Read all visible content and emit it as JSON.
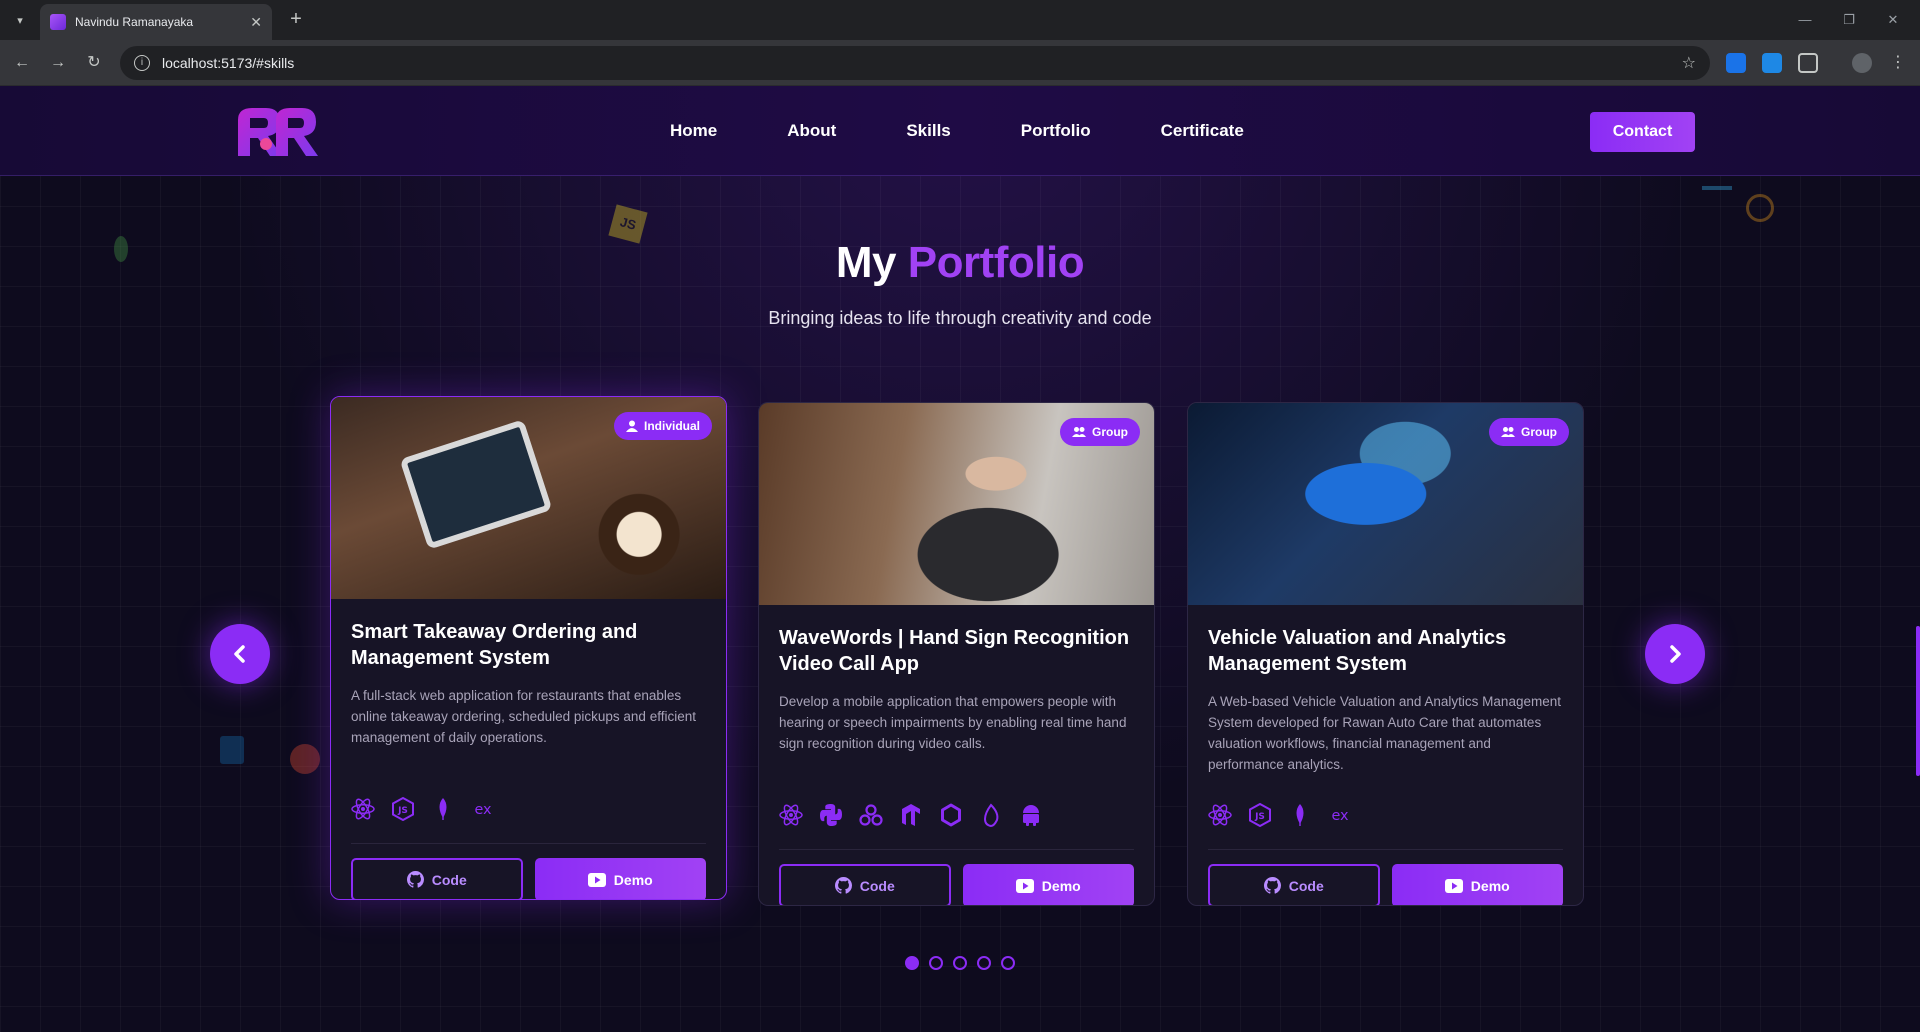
{
  "browser": {
    "tab_title": "Navindu Ramanayaka",
    "url": "localhost:5173/#skills"
  },
  "header": {
    "nav": [
      "Home",
      "About",
      "Skills",
      "Portfolio",
      "Certificate"
    ],
    "contact_label": "Contact"
  },
  "section": {
    "title_plain": "My",
    "title_accent": "Portfolio",
    "subtitle": "Bringing ideas to life through creativity and code"
  },
  "projects": [
    {
      "badge": "Individual",
      "badge_icon": "user-icon",
      "title": "Smart Takeaway Ordering and Management System",
      "description": "A full-stack web application for restaurants that enables online takeaway ordering, scheduled pickups and efficient management of daily operations.",
      "tech": [
        "react-icon",
        "nodejs-icon",
        "mongodb-icon",
        "express-icon"
      ],
      "code_label": "Code",
      "demo_label": "Demo"
    },
    {
      "badge": "Group",
      "badge_icon": "users-icon",
      "title": "WaveWords | Hand Sign Recognition Video Call App",
      "description": "Develop a mobile application that empowers people with hearing or speech impairments by enabling real time hand sign recognition during video calls.",
      "tech": [
        "react-icon",
        "python-icon",
        "webrtc-icon",
        "tensorflow-icon",
        "openai-icon",
        "firebase-icon",
        "android-icon"
      ],
      "code_label": "Code",
      "demo_label": "Demo"
    },
    {
      "badge": "Group",
      "badge_icon": "users-icon",
      "title": "Vehicle Valuation and Analytics Management System",
      "description": "A Web-based Vehicle Valuation and Analytics Management System developed for Rawan Auto Care that automates valuation workflows, financial management and performance analytics.",
      "tech": [
        "react-icon",
        "nodejs-icon",
        "mongodb-icon",
        "express-icon"
      ],
      "code_label": "Code",
      "demo_label": "Demo"
    }
  ],
  "pagination": {
    "total": 5,
    "active": 1
  },
  "colors": {
    "accent": "#8b2cf5",
    "accent_light": "#a142f4",
    "background": "#0e0b1e",
    "card": "#171426"
  }
}
